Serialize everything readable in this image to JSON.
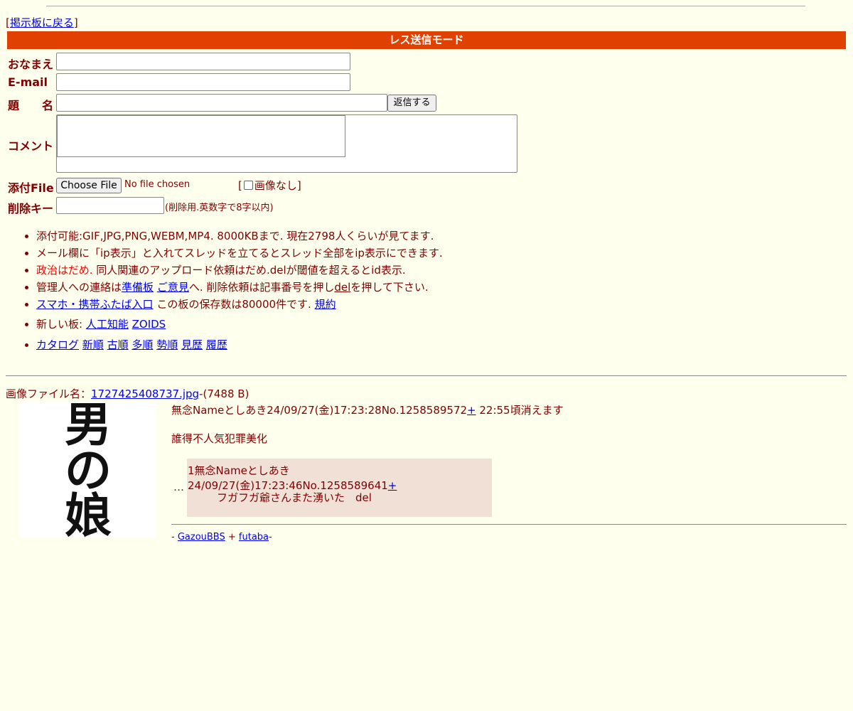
{
  "nav": {
    "back_link": "掲示板に戻る",
    "bracket_open": "[",
    "bracket_close": "]"
  },
  "mode_title": "レス送信モード",
  "form": {
    "name_label": "おなまえ",
    "email_label": "E-mail",
    "subject_label": "題　　名",
    "submit_label": "返信する",
    "comment_label": "コメント",
    "file_label": "添付File",
    "choose_file_label": "Choose File",
    "no_file_text": "No file chosen",
    "no_image_label": "画像なし",
    "delete_key_label": "削除キー",
    "delete_key_hint": "(削除用.英数字で8字以内)"
  },
  "notes": {
    "line1": "添付可能:GIF,JPG,PNG,WEBM,MP4. 8000KBまで. 現在2798人くらいが見てます.",
    "line2": "メール欄に「ip表示」と入れてスレッドを立てるとスレッド全部をip表示にできます.",
    "line3_red": "政治はだめ.",
    "line3_rest": " 同人関連のアップロード依頼はだめ.delが閾値を超えるとid表示.",
    "line4_pre": "管理人への連絡は",
    "line4_link1": "準備板",
    "line4_link2": "ご意見",
    "line4_mid": "へ. 削除依頼は記事番号を押し",
    "line4_del": "del",
    "line4_post": "を押して下さい.",
    "line5_link": "スマホ・携帯ふたば入口",
    "line5_mid": " この板の保存数は80000件です. ",
    "line5_rules": "規約",
    "line6_pre": "新しい板: ",
    "line6_link1": "人工知能",
    "line6_link2": "ZOIDS",
    "sort_links": [
      "カタログ",
      "新順",
      "古順",
      "多順",
      "勢順",
      "見歴",
      "履歴"
    ]
  },
  "thread": {
    "file_prefix": "画像ファイル名：",
    "file_name": "1727425408737.jpg",
    "file_size": "-(7488 B)",
    "thumb_text": [
      "男",
      "の",
      "娘"
    ],
    "op_header": "無念Nameとしあき24/09/27(金)17:23:28No.1258589572",
    "op_plus": "+",
    "op_expire": " 22:55頃消えます",
    "op_body": "誰得不人気犯罪美化",
    "ellipsis": "…",
    "reply_header": "1無念Nameとしあき24/09/27(金)17:23:46No.1258589641",
    "reply_plus": "+",
    "reply_body": "フガフガ爺さんまた湧いた　del"
  },
  "footer": {
    "dash1": "- ",
    "link1": "GazouBBS",
    "plus": " + ",
    "link2": "futaba",
    "dash2": "-"
  }
}
